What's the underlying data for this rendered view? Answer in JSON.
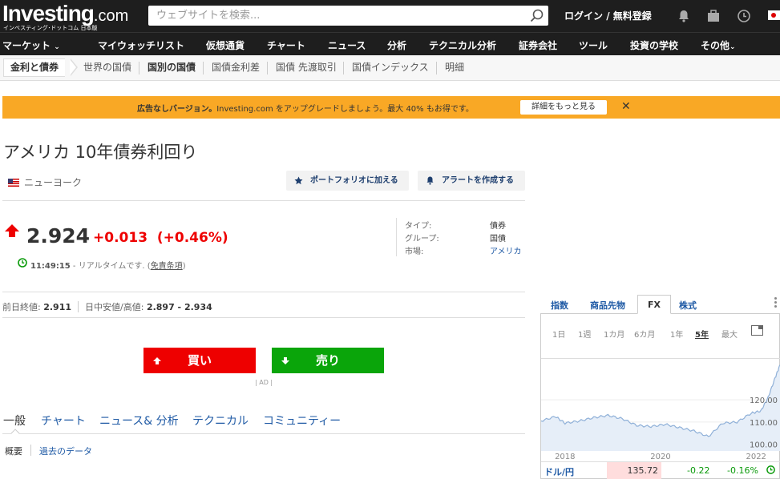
{
  "header": {
    "logo_main": "Investing",
    "logo_com": ".com",
    "logo_sub": "インベスティング･ドットコム 日本版",
    "search_placeholder": "ウェブサイトを検索...",
    "login": "ログイン",
    "login_sep": " / ",
    "register": "無料登録",
    "icons": [
      "bell-icon",
      "briefcase-icon",
      "clock-icon",
      "japan-flag-icon"
    ]
  },
  "mainnav": {
    "items": [
      "マーケット",
      "マイウォッチリスト",
      "仮想通貨",
      "チャート",
      "ニュース",
      "分析",
      "テクニカル分析",
      "証券会社",
      "ツール",
      "投資の学校",
      "その他"
    ]
  },
  "subnav": {
    "items": [
      "金利と債券",
      "世界の国債",
      "国別の国債",
      "国債金利差",
      "国債 先渡取引",
      "国債インデックス",
      "明細"
    ]
  },
  "promo": {
    "bold": "広告なしバージョン。",
    "text": "Investing.com をアップグレードしましょう。最大 40% もお得です。",
    "button": "詳細をもっと見る",
    "close": "✕"
  },
  "instrument": {
    "title": "アメリカ 10年債券利回り",
    "location": "ニューヨーク",
    "add_portfolio": "ポートフォリオに加える",
    "create_alert": "アラートを作成する",
    "price": "2.924",
    "change": "+0.013",
    "change_pct": "(+0.46%)",
    "time": "11:49:15",
    "realtime": " - リアルタイムです. (",
    "disclaimer": "免責条項",
    "realtime_end": ")",
    "info": [
      {
        "label": "タイプ:",
        "value": "債券"
      },
      {
        "label": "グループ:",
        "value": "国債"
      },
      {
        "label": "市場:",
        "value": "アメリカ"
      }
    ],
    "prev_close_label": "前日終値:",
    "prev_close": "2.911",
    "day_range_label": "日中安値/高値:",
    "day_range": "2.897 - 2.934",
    "buy": "買い",
    "sell": "売り",
    "ad": "| AD |"
  },
  "tabs": [
    "一般",
    "チャート",
    "ニュース& 分析",
    "テクニカル",
    "コミュニティー"
  ],
  "subtabs": [
    "概要",
    "過去のデータ"
  ],
  "widget": {
    "tabs": [
      "指数",
      "商品先物",
      "FX",
      "株式"
    ],
    "ranges": [
      "1日",
      "1週",
      "1カ月",
      "6カ月",
      "1年",
      "5年",
      "最大"
    ],
    "active_range": "5年",
    "fx": {
      "pair": "ドル/円",
      "last": "135.72",
      "change": "-0.22",
      "change_pct": "-0.16%"
    }
  },
  "chart_data": {
    "type": "line",
    "x": [
      2017.5,
      2017.8,
      2018.0,
      2018.3,
      2018.6,
      2018.9,
      2019.2,
      2019.5,
      2019.8,
      2020.1,
      2020.4,
      2020.7,
      2021.0,
      2021.3,
      2021.6,
      2021.9,
      2022.1,
      2022.25,
      2022.4,
      2022.5
    ],
    "values": [
      110.5,
      112.5,
      109.5,
      110.5,
      112.0,
      113.0,
      111.5,
      108.5,
      108.0,
      109.0,
      107.5,
      106.0,
      103.5,
      109.5,
      110.0,
      114.0,
      115.0,
      121.0,
      130.0,
      135.7
    ],
    "x_ticks": [
      "2018",
      "2020",
      "2022"
    ],
    "y_ticks": [
      "100.00",
      "110.00",
      "120.00"
    ],
    "ylim": [
      97,
      137
    ],
    "xlim": [
      2017.5,
      2022.5
    ]
  }
}
